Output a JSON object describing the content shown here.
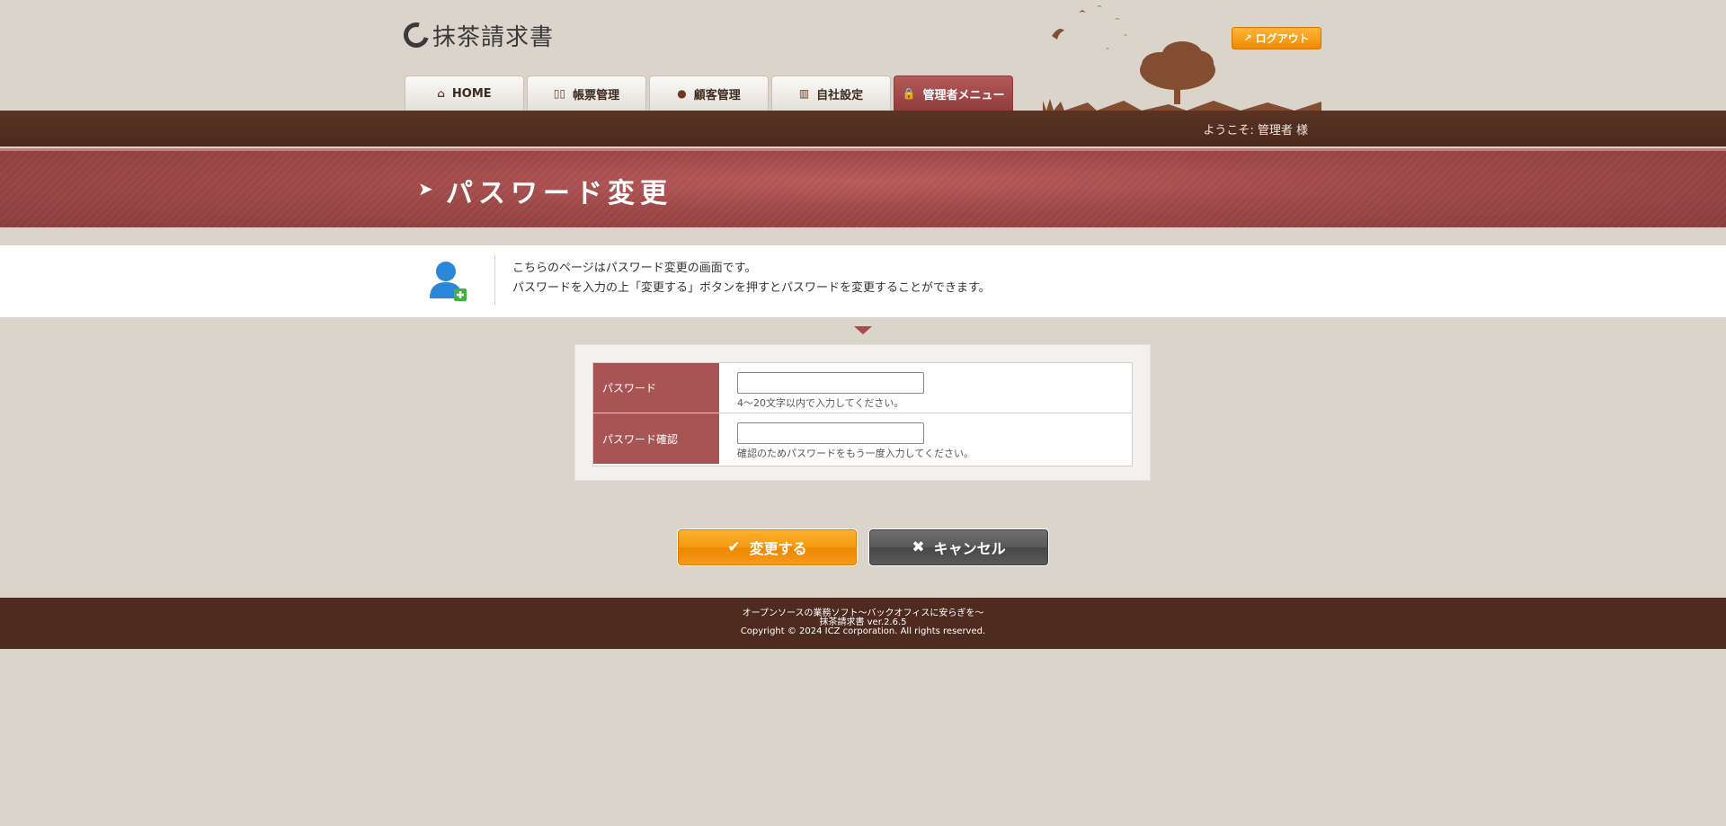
{
  "header": {
    "logo_text": "抹茶請求書",
    "logout_label": "ログアウト",
    "tabs": [
      {
        "label": "HOME",
        "icon": "home-icon"
      },
      {
        "label": "帳票管理",
        "icon": "book-icon"
      },
      {
        "label": "顧客管理",
        "icon": "person-icon"
      },
      {
        "label": "自社設定",
        "icon": "building-icon"
      },
      {
        "label": "管理者メニュー",
        "icon": "lock-icon",
        "active": true
      }
    ],
    "welcome": "ようこそ: 管理者 様"
  },
  "title": {
    "text": "パスワード変更"
  },
  "info": {
    "line1": "こちらのページはパスワード変更の画面です。",
    "line2": "パスワードを入力の上「変更する」ボタンを押すとパスワードを変更することができます。"
  },
  "form": {
    "password": {
      "label": "パスワード",
      "value": "",
      "hint": "4～20文字以内で入力してください。"
    },
    "password_confirm": {
      "label": "パスワード確認",
      "value": "",
      "hint": "確認のためパスワードをもう一度入力してください。"
    }
  },
  "buttons": {
    "submit_label": "変更する",
    "cancel_label": "キャンセル"
  },
  "footer": {
    "line1": "オープンソースの業務ソフト～バックオフィスに安らぎを～",
    "line2": "抹茶請求書 ver.2.6.5",
    "line3": "Copyright © 2024 ICZ corporation. All rights reserved."
  },
  "colors": {
    "accent_orange": "#f39a10",
    "header_brown": "#4e2a1f",
    "title_red": "#9d4747",
    "label_red": "#a85455"
  }
}
